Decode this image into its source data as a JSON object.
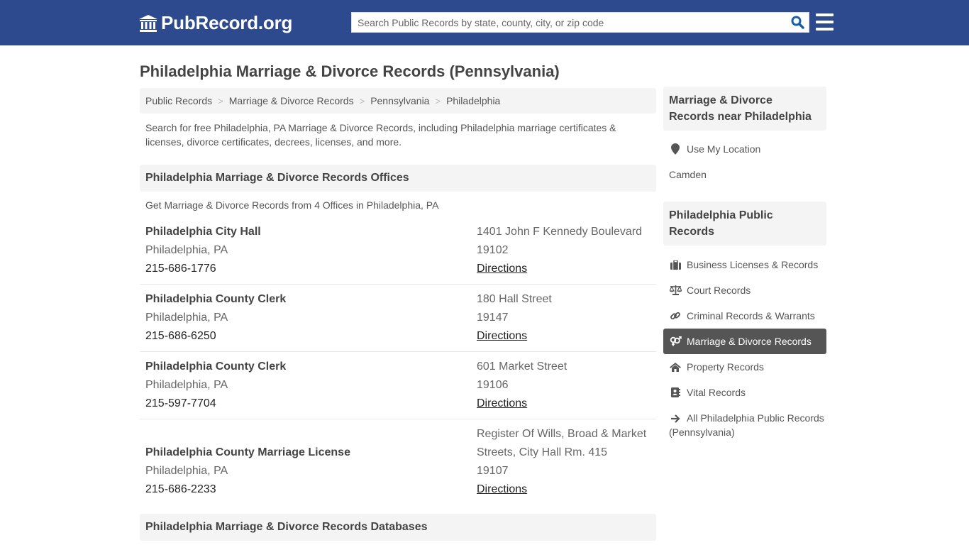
{
  "header": {
    "logo_text": "PubRecord.org",
    "search_placeholder": "Search Public Records by state, county, city, or zip code",
    "colors": {
      "topbar": "#2d4a8e",
      "search_icon": "#1a5fa8"
    }
  },
  "page": {
    "title": "Philadelphia Marriage & Divorce Records (Pennsylvania)",
    "breadcrumb": [
      "Public Records",
      "Marriage & Divorce Records",
      "Pennsylvania",
      "Philadelphia"
    ],
    "intro": "Search for free Philadelphia, PA Marriage & Divorce Records, including Philadelphia marriage certificates & licenses, divorce certificates, decrees, licenses, and more."
  },
  "offices": {
    "heading": "Philadelphia Marriage & Divorce Records Offices",
    "subheading": "Get Marriage & Divorce Records from 4 Offices in Philadelphia, PA",
    "items": [
      {
        "name": "Philadelphia City Hall",
        "city": "Philadelphia, PA",
        "phone": "215-686-1776",
        "address": [
          "1401 John F Kennedy Boulevard"
        ],
        "zip": "19102",
        "directions": "Directions"
      },
      {
        "name": "Philadelphia County Clerk",
        "city": "Philadelphia, PA",
        "phone": "215-686-6250",
        "address": [
          "180 Hall Street"
        ],
        "zip": "19147",
        "directions": "Directions"
      },
      {
        "name": "Philadelphia County Clerk",
        "city": "Philadelphia, PA",
        "phone": "215-597-7704",
        "address": [
          "601 Market Street"
        ],
        "zip": "19106",
        "directions": "Directions"
      },
      {
        "name": "Philadelphia County Marriage License",
        "city": "Philadelphia, PA",
        "phone": "215-686-2233",
        "address": [
          "Register Of Wills, Broad & Market",
          "Streets, City Hall Rm. 415"
        ],
        "zip": "19107",
        "directions": "Directions"
      }
    ]
  },
  "databases": {
    "heading": "Philadelphia Marriage & Divorce Records Databases"
  },
  "sidebar": {
    "nearby": {
      "heading": "Marriage & Divorce Records near Philadelphia",
      "use_location": "Use My Location",
      "places": [
        "Camden"
      ]
    },
    "public_records": {
      "heading": "Philadelphia Public Records",
      "items": [
        {
          "label": "Business Licenses & Records",
          "icon": "briefcase-icon"
        },
        {
          "label": "Court Records",
          "icon": "balance-scale-icon"
        },
        {
          "label": "Criminal Records & Warrants",
          "icon": "link-icon"
        },
        {
          "label": "Marriage & Divorce Records",
          "icon": "venus-mars-icon",
          "active": true
        },
        {
          "label": "Property Records",
          "icon": "home-icon"
        },
        {
          "label": "Vital Records",
          "icon": "address-book-icon"
        },
        {
          "label": "All Philadelphia Public Records (Pennsylvania)",
          "icon": "arrow-right-icon"
        }
      ]
    }
  }
}
